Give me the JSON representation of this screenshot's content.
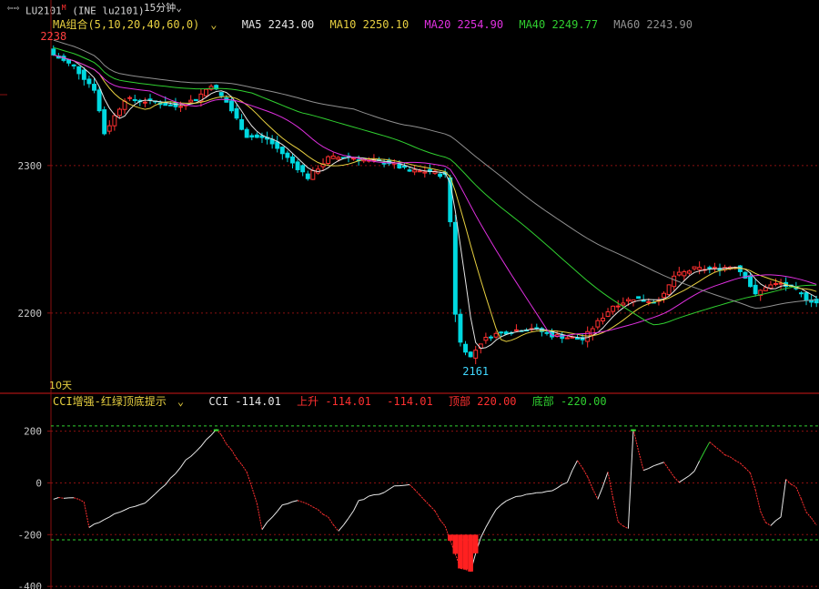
{
  "header": {
    "nav_arrows": "⇦⇨",
    "symbol": "LU2101",
    "symbol_mark": "M",
    "exchange_code": "(INE lu2101)",
    "period": "15分钟",
    "period_arrow": "⌄"
  },
  "ma_legend": {
    "group_label": "MA组合(5,10,20,40,60,0)",
    "items": [
      {
        "label": "MA5 2243.00",
        "color": "#e6e6e6"
      },
      {
        "label": "MA10 2250.10",
        "color": "#e8d040"
      },
      {
        "label": "MA20 2254.90",
        "color": "#e030e0"
      },
      {
        "label": "MA40 2249.77",
        "color": "#30d030"
      },
      {
        "label": "MA60 2243.90",
        "color": "#909090"
      }
    ]
  },
  "cci_legend": {
    "group_label": "CCI增强-红绿顶底提示",
    "items": [
      {
        "label": "CCI -114.01",
        "color": "#e6e6e6"
      },
      {
        "label": "上升 -114.01",
        "color": "#ff3030"
      },
      {
        "label": "-114.01",
        "color": "#ff3030"
      },
      {
        "label": "顶部 220.00",
        "color": "#ff3030"
      },
      {
        "label": "底部 -220.00",
        "color": "#30d030"
      }
    ]
  },
  "colors": {
    "up": "#ff3030",
    "down": "#00d8e0",
    "grid": "#8a1010",
    "axis_text": "#c8c8c8",
    "high_label": "#ff4040",
    "low_label": "#40d8ff",
    "cci_top_fill": "#30e030",
    "cci_bottom_fill": "#ff2020"
  },
  "chart_data": [
    {
      "type": "candlestick",
      "title": "",
      "y_ticks": [
        2200,
        2300
      ],
      "ylim": [
        2153,
        2390
      ],
      "period_label": "10天",
      "annotations": [
        {
          "text": "2238",
          "value": 2238,
          "kind": "high"
        },
        {
          "text": "2161",
          "value": 2161,
          "kind": "low"
        }
      ],
      "candles_note": "",
      "keypoints": [
        [
          0,
          2375
        ],
        [
          4,
          2367
        ],
        [
          8,
          2352
        ],
        [
          10,
          2322
        ],
        [
          14,
          2345
        ],
        [
          20,
          2343
        ],
        [
          24,
          2340
        ],
        [
          28,
          2345
        ],
        [
          31,
          2355
        ],
        [
          34,
          2343
        ],
        [
          38,
          2320
        ],
        [
          42,
          2318
        ],
        [
          46,
          2305
        ],
        [
          50,
          2292
        ],
        [
          54,
          2305
        ],
        [
          58,
          2306
        ],
        [
          62,
          2303
        ],
        [
          66,
          2302
        ],
        [
          70,
          2296
        ],
        [
          74,
          2296
        ],
        [
          77,
          2293
        ],
        [
          78,
          2262
        ],
        [
          79,
          2200
        ],
        [
          80,
          2180
        ],
        [
          82,
          2170
        ],
        [
          84,
          2180
        ],
        [
          86,
          2185
        ],
        [
          90,
          2188
        ],
        [
          94,
          2190
        ],
        [
          98,
          2185
        ],
        [
          102,
          2183
        ],
        [
          104,
          2182
        ],
        [
          106,
          2190
        ],
        [
          110,
          2205
        ],
        [
          114,
          2210
        ],
        [
          118,
          2208
        ],
        [
          120,
          2212
        ],
        [
          122,
          2225
        ],
        [
          126,
          2230
        ],
        [
          130,
          2230
        ],
        [
          134,
          2232
        ],
        [
          136,
          2225
        ],
        [
          138,
          2212
        ],
        [
          140,
          2218
        ],
        [
          143,
          2220
        ],
        [
          146,
          2215
        ],
        [
          148,
          2210
        ],
        [
          150,
          2207
        ]
      ],
      "ma": [
        {
          "name": "MA5",
          "period": 5
        },
        {
          "name": "MA10",
          "period": 10
        },
        {
          "name": "MA20",
          "period": 20
        },
        {
          "name": "MA40",
          "period": 40
        },
        {
          "name": "MA60",
          "period": 60
        }
      ]
    },
    {
      "type": "line",
      "title": "CCI",
      "y_ticks": [
        200,
        0,
        -200,
        -400
      ],
      "ylim": [
        -410,
        290
      ],
      "reference_lines": [
        220,
        -220,
        0,
        200,
        -200,
        -400
      ],
      "keypoints": [
        [
          0,
          -60
        ],
        [
          3,
          -55
        ],
        [
          6,
          -70
        ],
        [
          7,
          -170
        ],
        [
          10,
          -140
        ],
        [
          14,
          -105
        ],
        [
          18,
          -75
        ],
        [
          22,
          -5
        ],
        [
          26,
          85
        ],
        [
          29,
          140
        ],
        [
          32,
          210
        ],
        [
          35,
          125
        ],
        [
          38,
          45
        ],
        [
          40,
          -80
        ],
        [
          41,
          -180
        ],
        [
          43,
          -130
        ],
        [
          45,
          -85
        ],
        [
          48,
          -70
        ],
        [
          51,
          -90
        ],
        [
          54,
          -135
        ],
        [
          56,
          -190
        ],
        [
          58,
          -140
        ],
        [
          60,
          -70
        ],
        [
          62,
          -50
        ],
        [
          65,
          -40
        ],
        [
          67,
          -10
        ],
        [
          70,
          -5
        ],
        [
          73,
          -70
        ],
        [
          75,
          -110
        ],
        [
          77,
          -170
        ],
        [
          80,
          -330
        ],
        [
          82,
          -340
        ],
        [
          84,
          -210
        ],
        [
          87,
          -100
        ],
        [
          90,
          -60
        ],
        [
          94,
          -40
        ],
        [
          98,
          -30
        ],
        [
          101,
          0
        ],
        [
          103,
          90
        ],
        [
          105,
          20
        ],
        [
          107,
          -60
        ],
        [
          109,
          40
        ],
        [
          111,
          -150
        ],
        [
          113,
          -180
        ],
        [
          114,
          205
        ],
        [
          116,
          50
        ],
        [
          120,
          80
        ],
        [
          123,
          0
        ],
        [
          126,
          45
        ],
        [
          129,
          160
        ],
        [
          132,
          110
        ],
        [
          135,
          80
        ],
        [
          137,
          40
        ],
        [
          138,
          -30
        ],
        [
          139,
          -110
        ],
        [
          140,
          -150
        ],
        [
          141,
          -165
        ],
        [
          143,
          -130
        ],
        [
          144,
          10
        ],
        [
          146,
          -20
        ],
        [
          148,
          -110
        ],
        [
          150,
          -165
        ]
      ]
    }
  ]
}
